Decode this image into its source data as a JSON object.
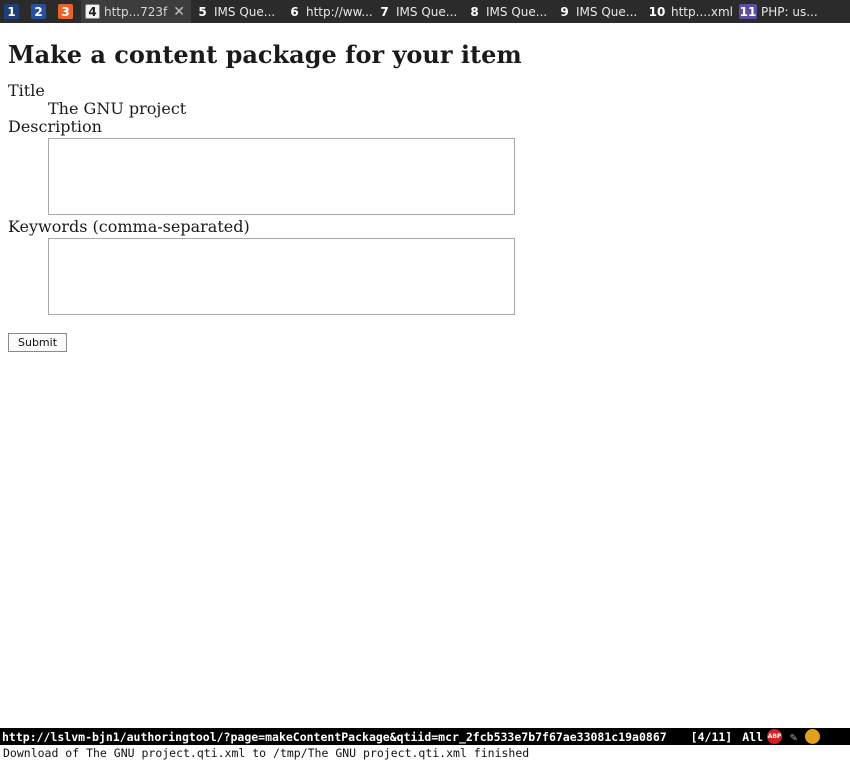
{
  "tabs": [
    {
      "num": "1",
      "label": ""
    },
    {
      "num": "2",
      "label": ""
    },
    {
      "num": "3",
      "label": ""
    },
    {
      "num": "4",
      "label": "http...723f",
      "active": true
    },
    {
      "num": "5",
      "label": "IMS Que..."
    },
    {
      "num": "6",
      "label": "http://ww..."
    },
    {
      "num": "7",
      "label": "IMS Que..."
    },
    {
      "num": "8",
      "label": "IMS Que..."
    },
    {
      "num": "9",
      "label": "IMS Que..."
    },
    {
      "num": "10",
      "label": "http....xml"
    },
    {
      "num": "11",
      "label": "PHP: us..."
    }
  ],
  "page": {
    "heading": "Make a content package for your item",
    "title_label": "Title",
    "title_value": "The GNU project",
    "description_label": "Description",
    "description_value": "",
    "keywords_label": "Keywords (comma-separated)",
    "keywords_value": "",
    "submit_label": "Submit"
  },
  "statusbar": {
    "url": "http://lslvm-bjn1/authoringtool/?page=makeContentPackage&qtiid=mcr_2fcb533e7b7f67ae33081c19a0867",
    "position": "[4/11]",
    "scroll": "All",
    "adblock_text": "ABP"
  },
  "message": "Download of The GNU project.qti.xml to /tmp/The GNU project.qti.xml finished"
}
